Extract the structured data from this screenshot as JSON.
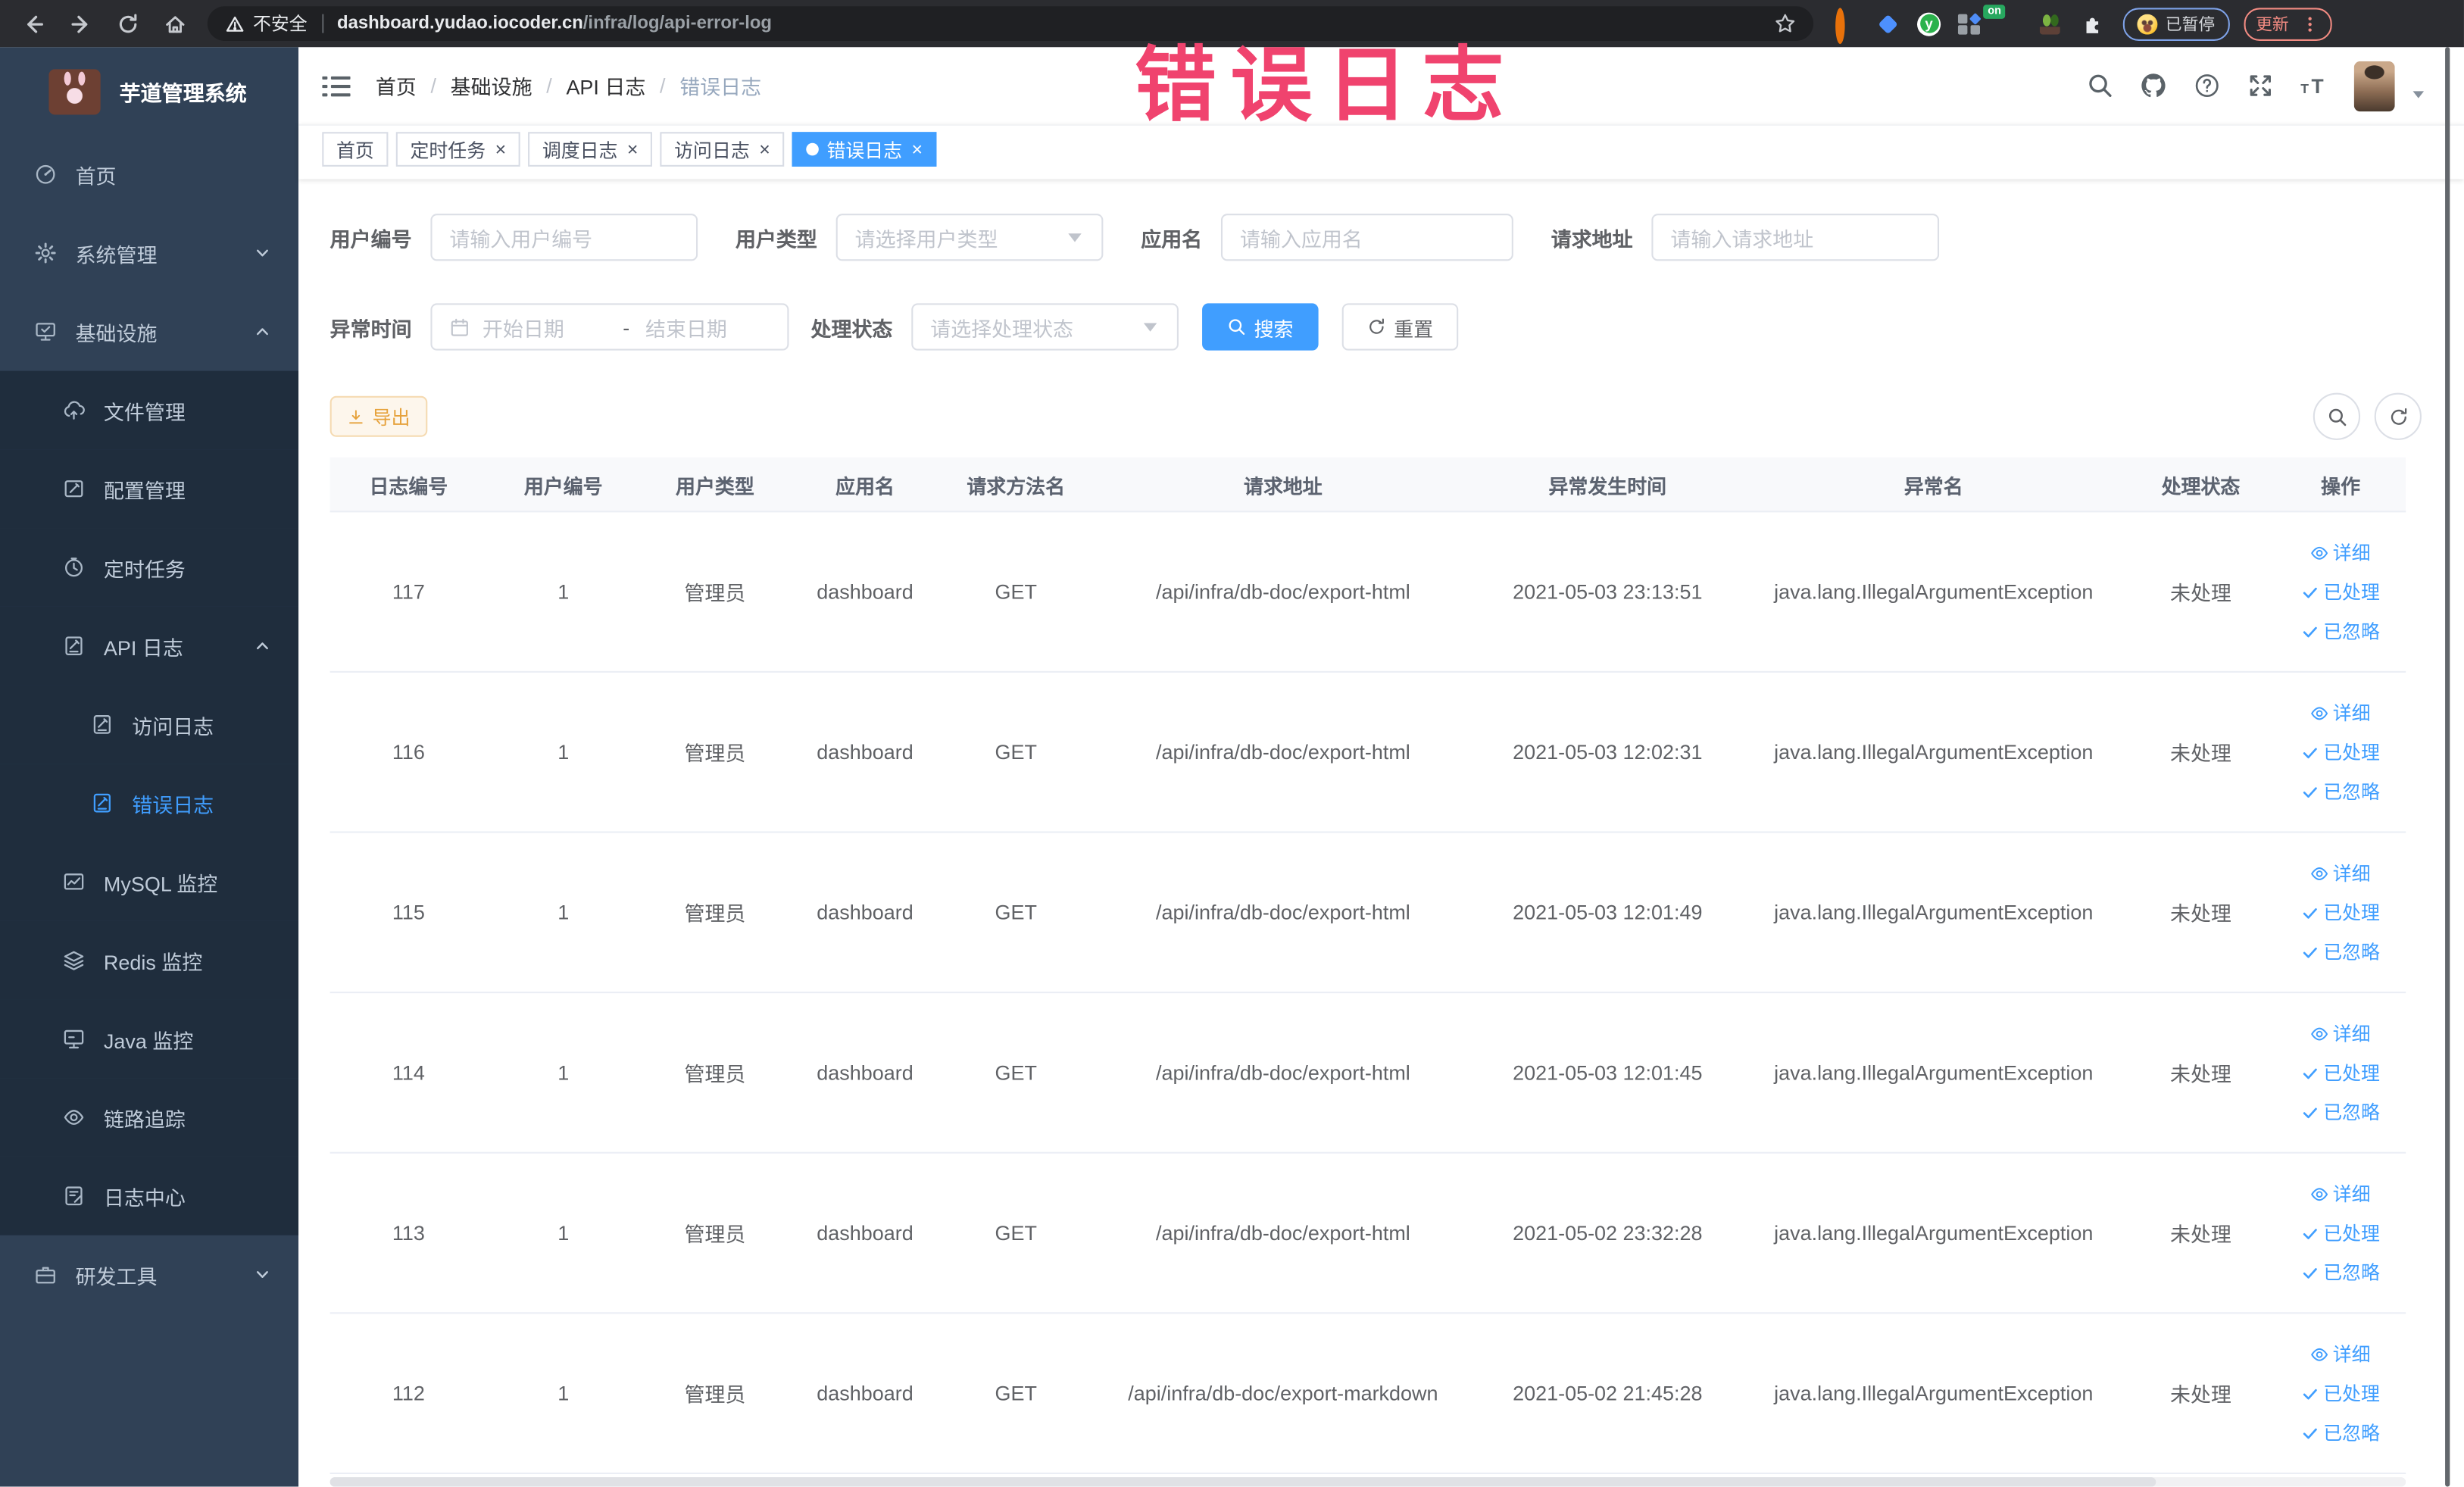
{
  "browser": {
    "security_label": "不安全",
    "url_host": "dashboard.yudao.iocoder.cn",
    "url_path": "/infra/log/api-error-log",
    "paused_badge": "已暂停",
    "update_button": "更新",
    "extensions": [
      {
        "name": "extension-orange-ring-icon",
        "shape": "circle",
        "color": "#e8710a"
      },
      {
        "name": "extension-blue-gem-icon",
        "shape": "diamond",
        "color": "#4d90fe"
      },
      {
        "name": "extension-green-letter-icon",
        "shape": "letter",
        "color": "#2bb24c",
        "letter": "y"
      },
      {
        "name": "extension-squares-icon",
        "shape": "squares",
        "color": "#9aa0a6"
      },
      {
        "name": "extension-on-badge-icon",
        "shape": "on",
        "color": "#27a85f",
        "label": "on"
      },
      {
        "name": "extension-plant-icon",
        "shape": "plant",
        "color": "#7cb342"
      },
      {
        "name": "extensions-puzzle-icon",
        "shape": "puzzle",
        "color": "#e8eaed"
      }
    ]
  },
  "sidebar": {
    "logo_title": "芋道管理系统",
    "items": [
      {
        "label": "首页",
        "icon": "gauge-icon",
        "level": 0
      },
      {
        "label": "系统管理",
        "icon": "gear-icon",
        "level": 0,
        "chevron": "down"
      },
      {
        "label": "基础设施",
        "icon": "monitor-check-icon",
        "level": 0,
        "chevron": "up"
      },
      {
        "label": "文件管理",
        "icon": "cloud-upload-icon",
        "level": 1,
        "dark": true
      },
      {
        "label": "配置管理",
        "icon": "edit-square-icon",
        "level": 1,
        "dark": true
      },
      {
        "label": "定时任务",
        "icon": "clock-icon",
        "level": 1,
        "dark": true
      },
      {
        "label": "API 日志",
        "icon": "log-icon",
        "level": 1,
        "dark": true,
        "chevron": "up"
      },
      {
        "label": "访问日志",
        "icon": "log-icon",
        "level": 2,
        "dark": true
      },
      {
        "label": "错误日志",
        "icon": "log-icon",
        "level": 2,
        "dark": true,
        "active": true
      },
      {
        "label": "MySQL 监控",
        "icon": "chart-icon",
        "level": 1,
        "dark": true
      },
      {
        "label": "Redis 监控",
        "icon": "layers-icon",
        "level": 1,
        "dark": true
      },
      {
        "label": "Java 监控",
        "icon": "display-icon",
        "level": 1,
        "dark": true
      },
      {
        "label": "链路追踪",
        "icon": "eye-icon",
        "level": 1,
        "dark": true
      },
      {
        "label": "日志中心",
        "icon": "notebook-icon",
        "level": 1,
        "dark": true
      },
      {
        "label": "研发工具",
        "icon": "briefcase-icon",
        "level": 0,
        "chevron": "down"
      }
    ]
  },
  "topbar": {
    "breadcrumb": [
      "首页",
      "基础设施",
      "API 日志",
      "错误日志"
    ],
    "icons": [
      "search-icon",
      "github-icon",
      "question-icon",
      "fullscreen-icon",
      "font-size-icon"
    ]
  },
  "tabs": [
    {
      "label": "首页",
      "closable": false,
      "active": false
    },
    {
      "label": "定时任务",
      "closable": true,
      "active": false
    },
    {
      "label": "调度日志",
      "closable": true,
      "active": false
    },
    {
      "label": "访问日志",
      "closable": true,
      "active": false
    },
    {
      "label": "错误日志",
      "closable": true,
      "active": true
    }
  ],
  "annotation": {
    "text": "错误日志",
    "color": "#f0436e"
  },
  "filters": {
    "user_id": {
      "label": "用户编号",
      "placeholder": "请输入用户编号"
    },
    "user_type": {
      "label": "用户类型",
      "placeholder": "请选择用户类型"
    },
    "app_name": {
      "label": "应用名",
      "placeholder": "请输入应用名"
    },
    "request_url": {
      "label": "请求地址",
      "placeholder": "请输入请求地址"
    },
    "exception_time": {
      "label": "异常时间",
      "start_placeholder": "开始日期",
      "separator": "-",
      "end_placeholder": "结束日期"
    },
    "process_status": {
      "label": "处理状态",
      "placeholder": "请选择处理状态"
    },
    "search_button": "搜索",
    "reset_button": "重置"
  },
  "toolbar": {
    "export_button": "导出"
  },
  "table": {
    "columns": [
      "日志编号",
      "用户编号",
      "用户类型",
      "应用名",
      "请求方法名",
      "请求地址",
      "异常发生时间",
      "异常名",
      "处理状态",
      "操作"
    ],
    "actions": [
      "详细",
      "已处理",
      "已忽略"
    ],
    "rows": [
      {
        "id": "117",
        "user_id": "1",
        "user_type": "管理员",
        "app": "dashboard",
        "method": "GET",
        "url": "/api/infra/db-doc/export-html",
        "time": "2021-05-03 23:13:51",
        "exception": "java.lang.IllegalArgumentException",
        "status": "未处理"
      },
      {
        "id": "116",
        "user_id": "1",
        "user_type": "管理员",
        "app": "dashboard",
        "method": "GET",
        "url": "/api/infra/db-doc/export-html",
        "time": "2021-05-03 12:02:31",
        "exception": "java.lang.IllegalArgumentException",
        "status": "未处理"
      },
      {
        "id": "115",
        "user_id": "1",
        "user_type": "管理员",
        "app": "dashboard",
        "method": "GET",
        "url": "/api/infra/db-doc/export-html",
        "time": "2021-05-03 12:01:49",
        "exception": "java.lang.IllegalArgumentException",
        "status": "未处理"
      },
      {
        "id": "114",
        "user_id": "1",
        "user_type": "管理员",
        "app": "dashboard",
        "method": "GET",
        "url": "/api/infra/db-doc/export-html",
        "time": "2021-05-03 12:01:45",
        "exception": "java.lang.IllegalArgumentException",
        "status": "未处理"
      },
      {
        "id": "113",
        "user_id": "1",
        "user_type": "管理员",
        "app": "dashboard",
        "method": "GET",
        "url": "/api/infra/db-doc/export-html",
        "time": "2021-05-02 23:32:28",
        "exception": "java.lang.IllegalArgumentException",
        "status": "未处理"
      },
      {
        "id": "112",
        "user_id": "1",
        "user_type": "管理员",
        "app": "dashboard",
        "method": "GET",
        "url": "/api/infra/db-doc/export-markdown",
        "time": "2021-05-02 21:45:28",
        "exception": "java.lang.IllegalArgumentException",
        "status": "未处理"
      }
    ]
  },
  "colors": {
    "primary": "#409EFF",
    "warning_text": "#E6A23C",
    "sidebar_bg": "#304156",
    "submenu_bg": "#1F2D3D",
    "annotation": "#F0436E",
    "chrome_bg": "#2B2C30"
  }
}
